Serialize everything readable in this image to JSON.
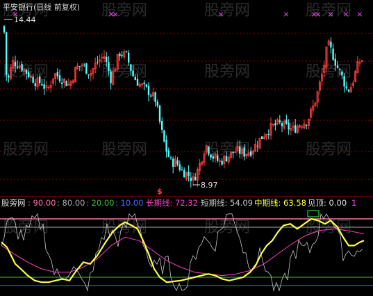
{
  "title": "平安银行(日线 前复权)",
  "watermark": "股旁网",
  "colors": {
    "bg": "#000000",
    "grid": "#8b0000",
    "up": "#ff3b3b",
    "down": "#54ffff",
    "title": "#d8d8d8",
    "xmark": "#ff48ff",
    "short": "#c8c8c8",
    "mid": "#ffff40",
    "long": "#ff40c8",
    "signal": "#40ff40",
    "lvl90": "#ff6fa6",
    "lvl80": "#aaaaaa",
    "lvl20": "#40c040",
    "lvl10": "#4070ff",
    "label_white": "#e0e0e0"
  },
  "price_panel": {
    "high_label": "14.44",
    "low_label": "8.97",
    "signal_marker": "$",
    "xmark_glyph": "×"
  },
  "indicator_panel": {
    "name": "股旁网",
    "levels": [
      {
        "label": ": 90.00",
        "value": 90
      },
      {
        "label": ": 80.00",
        "value": 80
      },
      {
        "label": ": 20.00",
        "value": 20
      },
      {
        "label": ": 10.00",
        "value": 10
      }
    ],
    "long_label": "长期线: 72.32",
    "short_label": "短期线: 54.09",
    "mid_label": "中期线: 63.58",
    "top_label": "见顶: 0.00",
    "end_marker": "1"
  },
  "chart_data": {
    "type": "candlestick",
    "title": "平安银行(日线 前复权)",
    "price_range": [
      8.6,
      14.9
    ],
    "annotations": {
      "max": 14.44,
      "min": 8.97
    },
    "indicator": {
      "range": [
        0,
        100
      ],
      "levels": [
        90,
        80,
        20,
        10
      ],
      "current": {
        "long": 72.32,
        "short": 54.09,
        "mid": 63.58,
        "top": 0.0
      }
    }
  }
}
